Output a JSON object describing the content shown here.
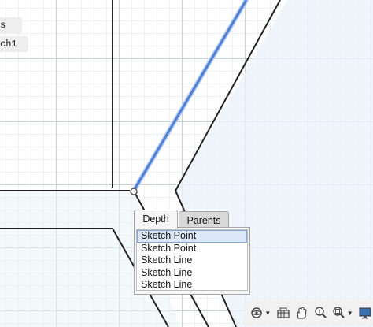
{
  "browser": {
    "items": [
      {
        "label": "s"
      },
      {
        "label": "ch1"
      }
    ]
  },
  "selection_panel": {
    "tabs": [
      {
        "label": "Depth",
        "active": true
      },
      {
        "label": "Parents",
        "active": false
      }
    ],
    "items": [
      {
        "label": "Sketch Point",
        "selected": true
      },
      {
        "label": "Sketch Point",
        "selected": false
      },
      {
        "label": "Sketch Line",
        "selected": false
      },
      {
        "label": "Sketch Line",
        "selected": false
      },
      {
        "label": "Sketch Line",
        "selected": false
      }
    ]
  },
  "navigation_bar": {
    "icons": [
      "orbit-icon",
      "look-at-icon",
      "pan-icon",
      "zoom-icon",
      "zoom-window-icon",
      "display-settings-icon"
    ]
  },
  "colors": {
    "selected_line": "#4f7fd6",
    "sketch_line": "#222222",
    "profile_fill": "#eaf2f8",
    "grid_major": "#c9d3dc",
    "grid_minor": "#eef1f4"
  }
}
